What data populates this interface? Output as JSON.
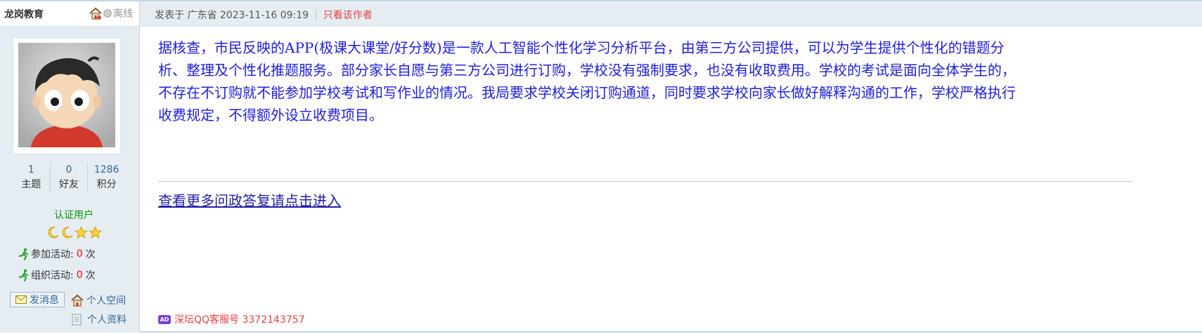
{
  "author": {
    "name": "龙岗教育",
    "status": "离线",
    "stats": [
      {
        "value": "1",
        "label": "主题"
      },
      {
        "value": "0",
        "label": "好友"
      },
      {
        "value": "1286",
        "label": "积分"
      }
    ],
    "verified": "认证用户",
    "level_icons": [
      "moon-icon",
      "moon-icon",
      "star-icon",
      "star-icon"
    ],
    "activity_join": {
      "label": "参加活动:",
      "count": "0",
      "unit": "次"
    },
    "activity_org": {
      "label": "组织活动:",
      "count": "0",
      "unit": "次"
    },
    "send_message": "发消息",
    "personal_space": "个人空间",
    "personal_profile": "个人资料"
  },
  "post": {
    "meta": "发表于 广东省 2023-11-16 09:19",
    "author_only": "只看该作者",
    "body_lines": [
      "据核查，市民反映的APP(极课大课堂/好分数)是一款人工智能个性化学习分析平台，由第三方公司提供，可以为学生提供个性化的错题分",
      "析、整理及个性化推题服务。部分家长自愿与第三方公司进行订购，学校没有强制要求，也没有收取费用。学校的考试是面向全体学生的，",
      "不存在不订购就不能参加学校考试和写作业的情况。我局要求学校关闭订购通道，同时要求学校向家长做好解释沟通的工作，学校严格执行",
      "收费规定，不得额外设立收费项目。"
    ],
    "more_link": "查看更多问政答复请点击进入",
    "ad_badge": "AD",
    "ad_text": "深坛QQ客服号 3372143757"
  },
  "colors": {
    "body_text": "#2020dd",
    "link": "#336699",
    "red": "#e84040",
    "header_bg": "#e5edf2"
  }
}
